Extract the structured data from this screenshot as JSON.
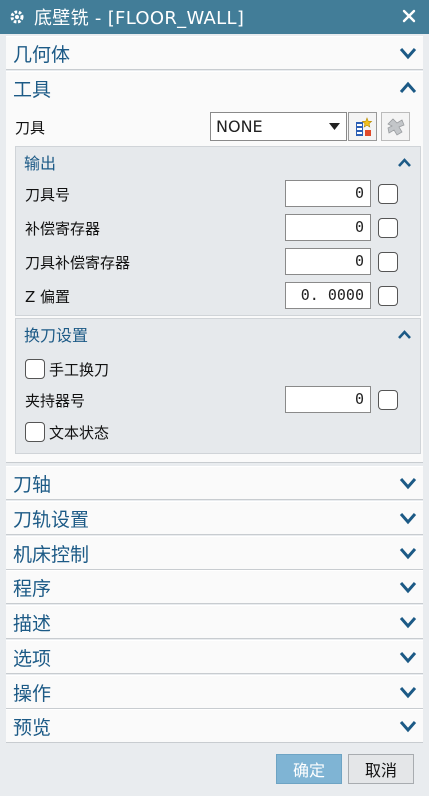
{
  "window": {
    "title": "底壁铣 - [FLOOR_WALL]"
  },
  "sections": {
    "geometry": "几何体",
    "tool": "工具",
    "tool_axis": "刀轴",
    "path_settings": "刀轨设置",
    "machine_control": "机床控制",
    "program": "程序",
    "description": "描述",
    "options": "选项",
    "actions": "操作",
    "preview": "预览"
  },
  "tool": {
    "label": "刀具",
    "selected": "NONE"
  },
  "output": {
    "title": "输出",
    "tool_number": {
      "label": "刀具号",
      "value": "0"
    },
    "adjust_register": {
      "label": "补偿寄存器",
      "value": "0"
    },
    "cutcom_register": {
      "label": "刀具补偿寄存器",
      "value": "0"
    },
    "z_offset": {
      "label": "Z 偏置",
      "value": "0. 0000"
    }
  },
  "tool_change": {
    "title": "换刀设置",
    "manual_change": "手工换刀",
    "holder_number": {
      "label": "夹持器号",
      "value": "0"
    },
    "text_status": "文本状态"
  },
  "buttons": {
    "ok": "确定",
    "cancel": "取消"
  },
  "colors": {
    "titlebar": "#427d98",
    "section_title": "#1c5a86",
    "ok_button": "#7fb4d4"
  }
}
